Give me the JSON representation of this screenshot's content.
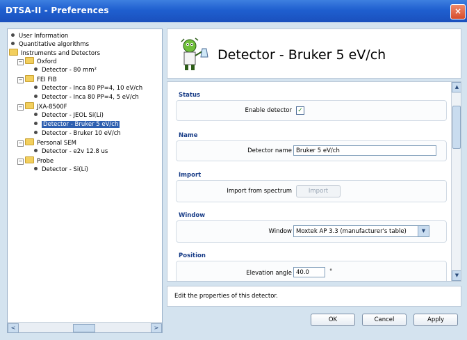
{
  "window": {
    "title": "DTSA-II - Preferences",
    "close_label": "×"
  },
  "tree": {
    "items": [
      {
        "label": "User Information",
        "type": "leaf",
        "level": 0
      },
      {
        "label": "Quantitative algorithms",
        "type": "leaf",
        "level": 0
      },
      {
        "label": "Instruments and Detectors",
        "type": "folder",
        "level": 0
      },
      {
        "label": "Oxford",
        "type": "folder",
        "level": 1
      },
      {
        "label": "Detector - 80 mm²",
        "type": "leaf",
        "level": 2
      },
      {
        "label": "FEI FIB",
        "type": "folder",
        "level": 1
      },
      {
        "label": "Detector - Inca 80 PP=4, 10 eV/ch",
        "type": "leaf",
        "level": 2
      },
      {
        "label": "Detector - Inca 80 PP=4, 5 eV/ch",
        "type": "leaf",
        "level": 2
      },
      {
        "label": "JXA-8500F",
        "type": "folder",
        "level": 1
      },
      {
        "label": "Detector - JEOL Si(Li)",
        "type": "leaf",
        "level": 2
      },
      {
        "label": "Detector - Bruker 5 eV/ch",
        "type": "leaf",
        "level": 2,
        "selected": true
      },
      {
        "label": "Detector - Bruker 10 eV/ch",
        "type": "leaf",
        "level": 2
      },
      {
        "label": "Personal SEM",
        "type": "folder",
        "level": 1
      },
      {
        "label": "Detector - e2v 12.8 us",
        "type": "leaf",
        "level": 2
      },
      {
        "label": "Probe",
        "type": "folder",
        "level": 1
      },
      {
        "label": "Detector - Si(Li)",
        "type": "leaf",
        "level": 2
      }
    ],
    "expander_glyph": "−",
    "scroll_left": "<",
    "scroll_right": ">"
  },
  "header": {
    "title": "Detector - Bruker 5 eV/ch",
    "icon": "lab-mascot-icon"
  },
  "form": {
    "status": {
      "section": "Status",
      "enable_label": "Enable detector",
      "enabled": true,
      "check_glyph": "✓"
    },
    "name": {
      "section": "Name",
      "label": "Detector name",
      "value": "Bruker 5 eV/ch"
    },
    "import": {
      "section": "Import",
      "label": "Import from spectrum",
      "button": "Import"
    },
    "window": {
      "section": "Window",
      "label": "Window",
      "value": "Moxtek AP 3.3 (manufacturer's table)",
      "drop_glyph": "▼"
    },
    "position": {
      "section": "Position",
      "label": "Elevation angle",
      "value": "40.0",
      "unit": "°"
    },
    "scroll_up": "▲",
    "scroll_down": "▼"
  },
  "status_bar": {
    "text": "Edit the properties of this detector."
  },
  "buttons": {
    "ok": "OK",
    "cancel": "Cancel",
    "apply": "Apply"
  },
  "colors": {
    "titlebar": "#1f5fcf",
    "selection": "#2e5fb0",
    "section_title": "#1a3e88",
    "background": "#d4e3ef"
  }
}
